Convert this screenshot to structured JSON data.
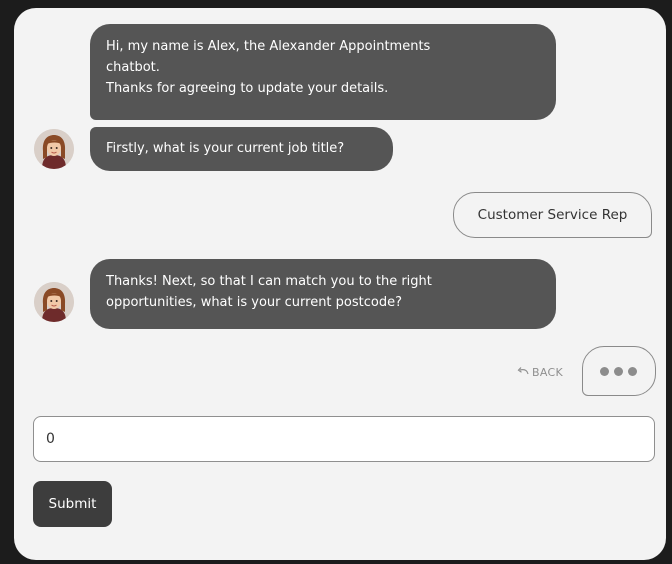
{
  "chat": {
    "messages": [
      {
        "sender": "bot",
        "lines": [
          "Hi, my name is Alex, the Alexander Appointments",
          "chatbot.",
          "Thanks for agreeing to update your details."
        ]
      },
      {
        "sender": "bot",
        "lines": [
          "Firstly, what is your current job title?"
        ]
      },
      {
        "sender": "user",
        "lines": [
          "Customer Service Rep"
        ]
      },
      {
        "sender": "bot",
        "lines": [
          "Thanks! Next, so that I can match you to the right",
          "opportunities, what is your current postcode?"
        ]
      }
    ],
    "back_label": "BACK",
    "typing_indicator": "•••"
  },
  "form": {
    "input_value": "0",
    "submit_label": "Submit"
  },
  "colors": {
    "page_background": "#1c1c1c",
    "panel_background": "#f3f3f3",
    "bot_bubble": "#555555",
    "submit_button": "#3d3d3d"
  },
  "icons": {
    "back": "undo-arrow-icon",
    "avatar": "bot-avatar-icon"
  }
}
